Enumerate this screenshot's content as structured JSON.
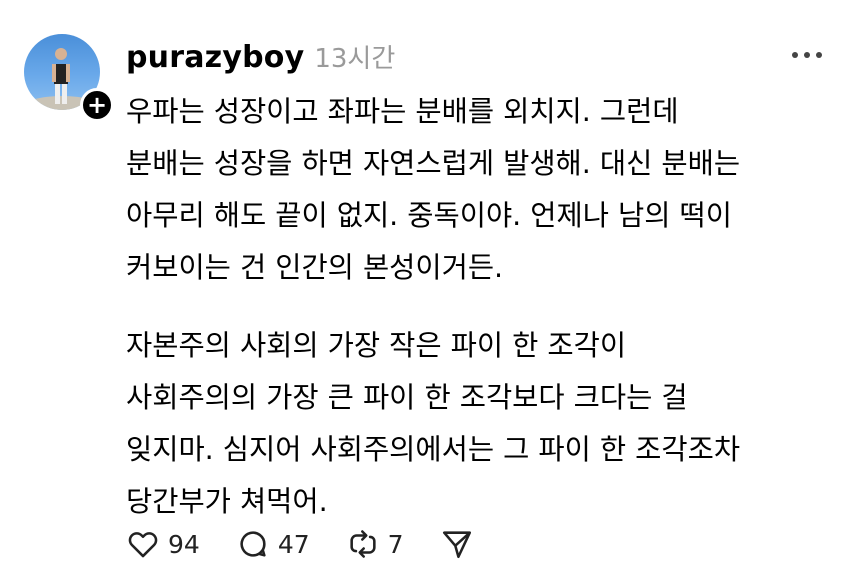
{
  "post": {
    "username": "purazyboy",
    "time": "13시간",
    "paragraphs": [
      [
        "우파는 성장이고 좌파는 분배를 외치지. 그런데",
        "분배는 성장을 하면 자연스럽게 발생해. 대신 분배는",
        "아무리 해도 끝이 없지. 중독이야. 언제나 남의 떡이",
        "커보이는 건 인간의 본성이거든."
      ],
      [
        "자본주의 사회의 가장 작은 파이 한 조각이",
        "사회주의의 가장 큰 파이 한 조각보다 크다는 걸",
        "잊지마. 심지어 사회주의에서는 그 파이 한 조각조차",
        "당간부가 쳐먹어."
      ]
    ]
  },
  "actions": {
    "likes": "94",
    "comments": "47",
    "reposts": "7"
  }
}
